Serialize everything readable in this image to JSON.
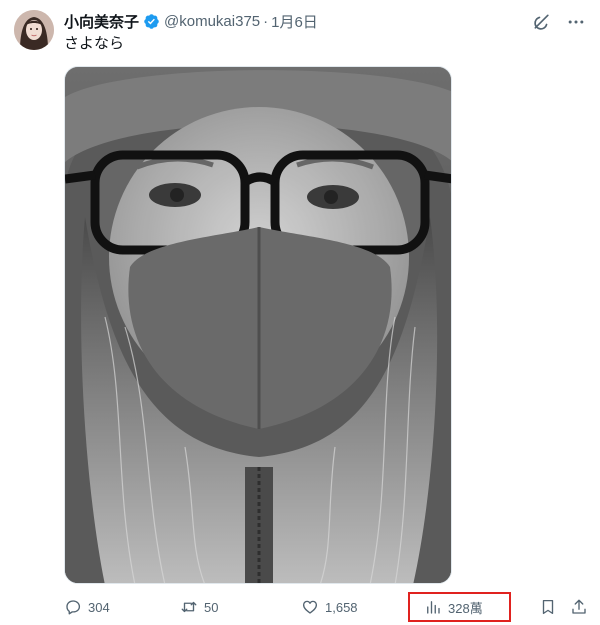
{
  "tweet": {
    "author_name": "小向美奈子",
    "handle": "@komukai375",
    "separator": "·",
    "date": "1月6日",
    "text": "さよなら"
  },
  "icons": {
    "avatar": "profile-photo",
    "verified": "verified-badge-icon",
    "grok": "grok-icon",
    "more": "more-icon",
    "reply": "reply-icon",
    "retweet": "retweet-icon",
    "like": "heart-icon",
    "views": "views-chart-icon",
    "bookmark": "bookmark-icon",
    "share": "share-icon"
  },
  "stats": {
    "replies": "304",
    "retweets": "50",
    "likes": "1,658",
    "views": "328萬"
  },
  "colors": {
    "text": "#0f1419",
    "secondary": "#536471",
    "verified_blue": "#1d9bf0",
    "highlight_border": "#e0221f"
  }
}
